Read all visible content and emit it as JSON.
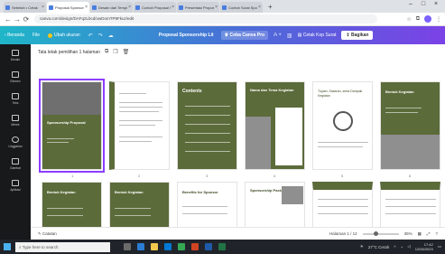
{
  "browser": {
    "tabs": [
      {
        "label": "Sebelah • Cetak"
      },
      {
        "label": "Proposal Sponsorship"
      },
      {
        "label": "Desain dari Template"
      },
      {
        "label": "Contoh Proposal Sp"
      },
      {
        "label": "Presentasi Proposal"
      },
      {
        "label": "Contoh Surat Spons"
      }
    ],
    "new_tab": "+",
    "address": "canva.com/design/DAFq2Lbcd/uwDomTP8Fkuz/edit",
    "window_controls": {
      "minimize": "–",
      "maximize": "□",
      "close": "×"
    }
  },
  "header": {
    "home": "Beranda",
    "file": "File",
    "resize": "Ubah ukuran",
    "title": "Proposal Sponsorship Lit",
    "try_pro": "Coba Canva Pro",
    "print": "Cetak Kop Surat",
    "share": "Bagikan"
  },
  "sidebar": {
    "items": [
      {
        "label": "Desain"
      },
      {
        "label": "Elemen"
      },
      {
        "label": "Teks"
      },
      {
        "label": "Merek"
      },
      {
        "label": "Unggahan"
      },
      {
        "label": "Gambar"
      },
      {
        "label": "Aplikasi"
      }
    ]
  },
  "grid": {
    "header": "Tata letak pemilihan 1 halaman",
    "pages": [
      {
        "num": "1",
        "title": "Sponsorship Proposal"
      },
      {
        "num": "2",
        "title": ""
      },
      {
        "num": "3",
        "title": "Contents"
      },
      {
        "num": "4",
        "title": "Nama dan Tema Kegiatan"
      },
      {
        "num": "5",
        "title": "Tujuan, Sasaran, serta Dampak Kegiatan"
      },
      {
        "num": "6",
        "title": "Bentuk Kegiatan"
      },
      {
        "num": "7",
        "title": "Bentuk Kegiatan"
      },
      {
        "num": "8",
        "title": "Bentuk Kegiatan"
      },
      {
        "num": "9",
        "title": "Benefits for Sponsor"
      },
      {
        "num": "10",
        "title": "Sponsorship Packages"
      },
      {
        "num": "11",
        "title": ""
      },
      {
        "num": "12",
        "title": ""
      }
    ]
  },
  "status": {
    "notes": "Catatan",
    "page_indicator": "Halaman 1 / 12",
    "zoom": "35%"
  },
  "taskbar": {
    "search_placeholder": "Type here to search",
    "weather": "27°C Cerah",
    "time": "17:42",
    "date": "12/06/2023"
  },
  "colors": {
    "olive": "#5c6b3a",
    "canva_gradient_start": "#1fb6c8",
    "canva_gradient_end": "#7b42e6",
    "selection": "#8b3dff"
  }
}
